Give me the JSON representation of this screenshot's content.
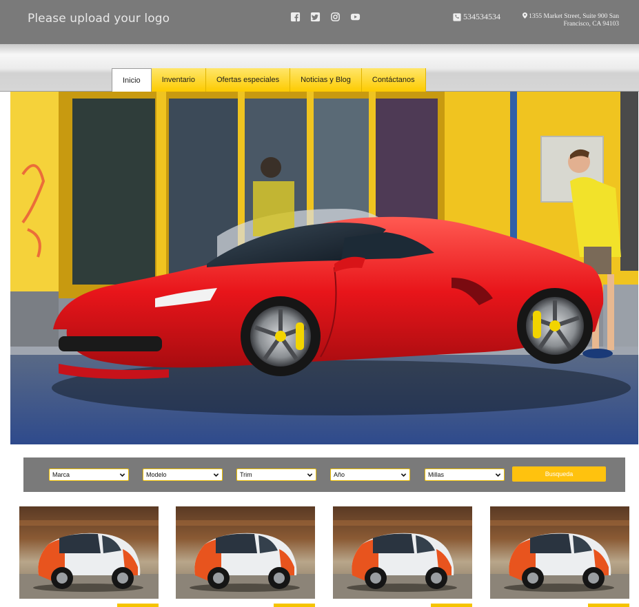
{
  "header": {
    "logo_text": "Please upload your logo",
    "social_icons": [
      "facebook-icon",
      "twitter-icon",
      "instagram-icon",
      "youtube-icon"
    ],
    "phone": "534534534",
    "address_line1": "1355 Market Street, Suite 900 San",
    "address_line2": "Francisco, CA 94103"
  },
  "nav": {
    "tabs": [
      {
        "label": "Inicio",
        "active": true
      },
      {
        "label": "Inventario",
        "active": false
      },
      {
        "label": "Ofertas especiales",
        "active": false
      },
      {
        "label": "Noticias y Blog",
        "active": false
      },
      {
        "label": "Contáctanos",
        "active": false
      }
    ]
  },
  "search": {
    "filters": [
      "Marca",
      "Modelo",
      "Trim",
      "Año",
      "Millas"
    ],
    "button_label": "Busqueda"
  },
  "listings": [
    {
      "image": "orange-white-smart-car"
    },
    {
      "image": "orange-white-smart-car"
    },
    {
      "image": "orange-white-smart-car"
    },
    {
      "image": "orange-white-smart-car"
    }
  ],
  "colors": {
    "header_bg": "#7a7a7a",
    "accent_yellow": "#ffc20e",
    "tab_yellow": "#fdcb00",
    "search_bg": "#7a7a7a"
  }
}
